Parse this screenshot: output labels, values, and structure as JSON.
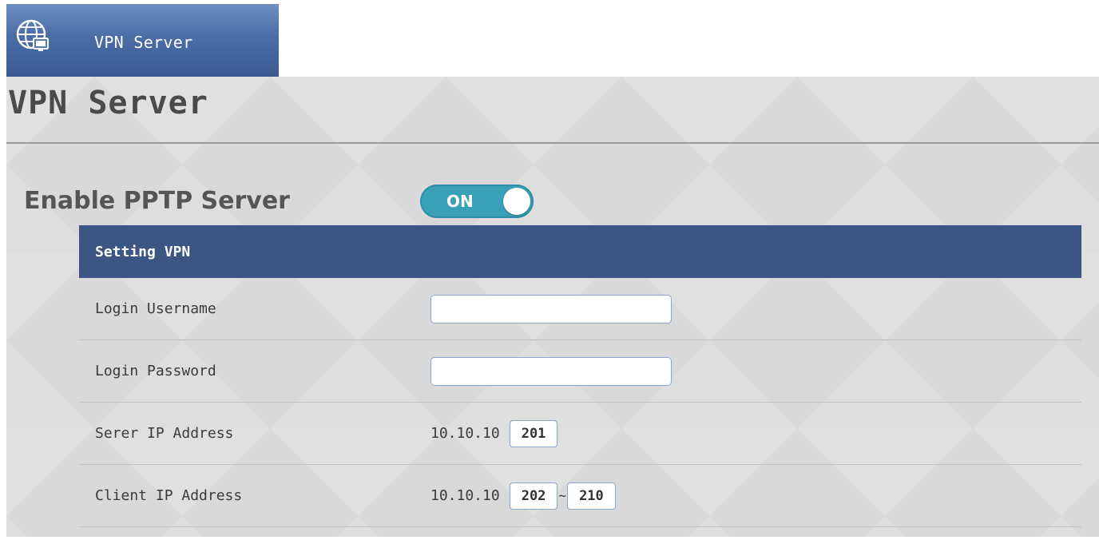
{
  "sidebar": {
    "item_label": "VPN Server",
    "item_icon": "globe-icon",
    "item_color": "#4b6da6"
  },
  "page": {
    "title": "VPN Server"
  },
  "pptp": {
    "label": "Enable PPTP Server",
    "toggle_state": "ON",
    "toggle_color": "#3aa0b8"
  },
  "settings": {
    "header": "Setting VPN",
    "header_color": "#3b5584",
    "rows": [
      {
        "label": "Login Username",
        "value": ""
      },
      {
        "label": "Login Password",
        "value": ""
      },
      {
        "label": "Serer IP Address",
        "prefix": "10.10.10",
        "value": "201"
      },
      {
        "label": "Client IP Address",
        "prefix": "10.10.10",
        "start": "202",
        "separator": "~",
        "end": "210"
      }
    ]
  }
}
